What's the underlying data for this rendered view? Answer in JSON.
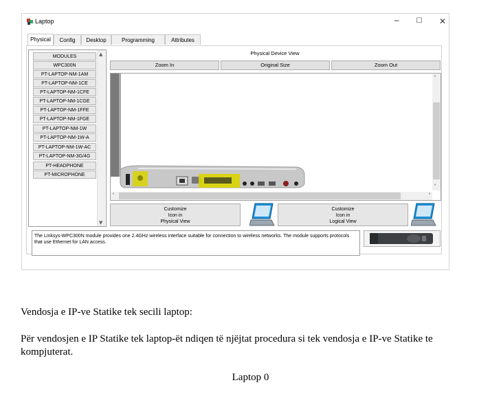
{
  "window": {
    "title": "Laptop",
    "controls": {
      "minimize": "─",
      "maximize": "☐",
      "close": "✕"
    },
    "tabs": [
      "Physical",
      "Config",
      "Desktop",
      "Programming",
      "Attributes"
    ],
    "active_tab": "Physical",
    "modules": [
      "MODULES",
      "WPC300N",
      "PT-LAPTOP-NM-1AM",
      "PT-LAPTOP-NM-1CE",
      "PT-LAPTOP-NM-1CFE",
      "PT-LAPTOP-NM-1CGE",
      "PT-LAPTOP-NM-1FFE",
      "PT-LAPTOP-NM-1FGE",
      "PT-LAPTOP-NM-1W",
      "PT-LAPTOP-NM-1W-A",
      "PT-LAPTOP-NM-1W-AC",
      "PT-LAPTOP-NM-3G/4G",
      "PT-HEADPHONE",
      "PT-MICROPHONE"
    ],
    "physical_view_title": "Physical Device View",
    "zoom_buttons": {
      "zoom_in": "Zoom In",
      "original_size": "Original Size",
      "zoom_out": "Zoom Out"
    },
    "customize_physical": [
      "Customize",
      "Icon in",
      "Physical View"
    ],
    "customize_logical": [
      "Customize",
      "Icon in",
      "Logical View"
    ],
    "description": "The Linksys-WPC300N module provides one 2.4GHz wireless interface suitable for connection to wireless networks. The module supports protocols that use Ethernet for LAN access.",
    "colors": {
      "highlight": "#d9d400",
      "laptop_blue": "#1e8fd6"
    }
  },
  "document": {
    "heading": "Vendosja e IP-ve Statike tek secili laptop:",
    "paragraph": "Për vendosjen e IP Statike tek laptop-ët ndiqen të njëjtat procedura si tek vendosja e IP-ve Statike te kompjuterat.",
    "caption": "Laptop 0"
  }
}
